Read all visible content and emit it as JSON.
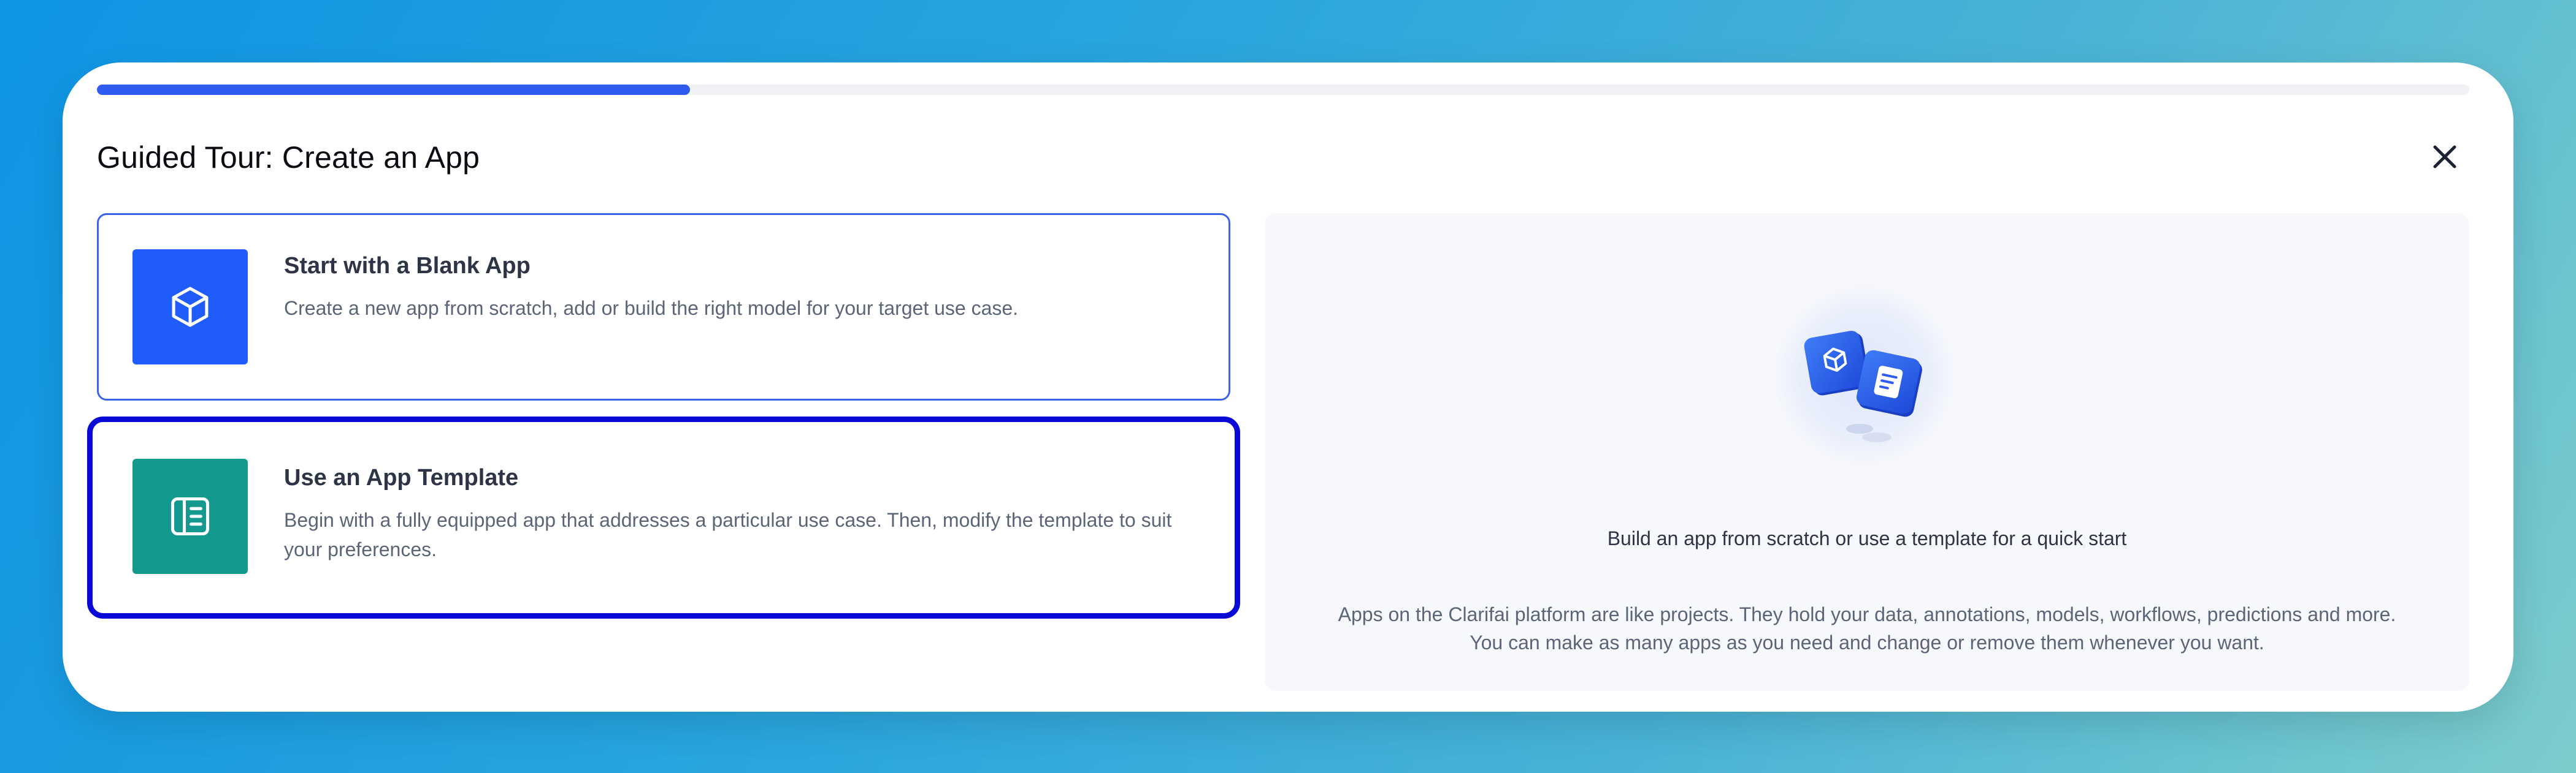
{
  "modal": {
    "progress_fraction": 0.25,
    "title": "Guided Tour: Create an App",
    "close_icon": "close-icon"
  },
  "options": [
    {
      "title": "Start with a Blank App",
      "description": "Create a new app from scratch, add or build the right model for your target use case.",
      "icon": "cube-icon",
      "icon_bg": "#1f5cfa"
    },
    {
      "title": "Use an App Template",
      "description": "Begin with a fully equipped app that addresses a particular use case. Then, modify the template to suit your preferences.",
      "icon": "template-icon",
      "icon_bg": "#14998f"
    }
  ],
  "info": {
    "heading": "Build an app from scratch or use a template for a quick start",
    "body_line1": "Apps on the Clarifai platform are like projects. They hold your data, annotations, models, workflows, predictions and more.",
    "body_line2": "You can make as many apps as you need and change or remove them whenever you want."
  },
  "colors": {
    "accent": "#2f5bf0",
    "selected_border": "#0a0ad6"
  }
}
